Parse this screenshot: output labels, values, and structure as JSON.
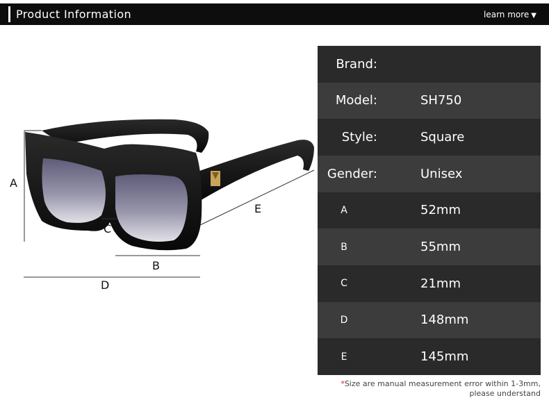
{
  "header": {
    "title": "Product Information",
    "learn_more": "learn more",
    "arrow_icon": "▼"
  },
  "diagram": {
    "labels": {
      "a": "A",
      "b": "B",
      "c": "C",
      "d": "D",
      "e": "E"
    }
  },
  "specs": [
    {
      "label": "Brand:",
      "value": ""
    },
    {
      "label": "Model:",
      "value": "SH750"
    },
    {
      "label": "Style:",
      "value": "Square"
    },
    {
      "label": "Gender:",
      "value": "Unisex"
    },
    {
      "label": "A",
      "value": "52mm"
    },
    {
      "label": "B",
      "value": "55mm"
    },
    {
      "label": "C",
      "value": "21mm"
    },
    {
      "label": "D",
      "value": "148mm"
    },
    {
      "label": "E",
      "value": "145mm"
    }
  ],
  "footnote": {
    "star": "*",
    "line1": "Size are manual measurement error within 1-3mm,",
    "line2": "please understand"
  },
  "colors": {
    "header_bg": "#0d0d0d",
    "row_dark": "#2a2a2a",
    "row_light": "#3c3c3c",
    "frame": "#111111",
    "lens": "#7a7890",
    "stud": "#c8a35a"
  }
}
